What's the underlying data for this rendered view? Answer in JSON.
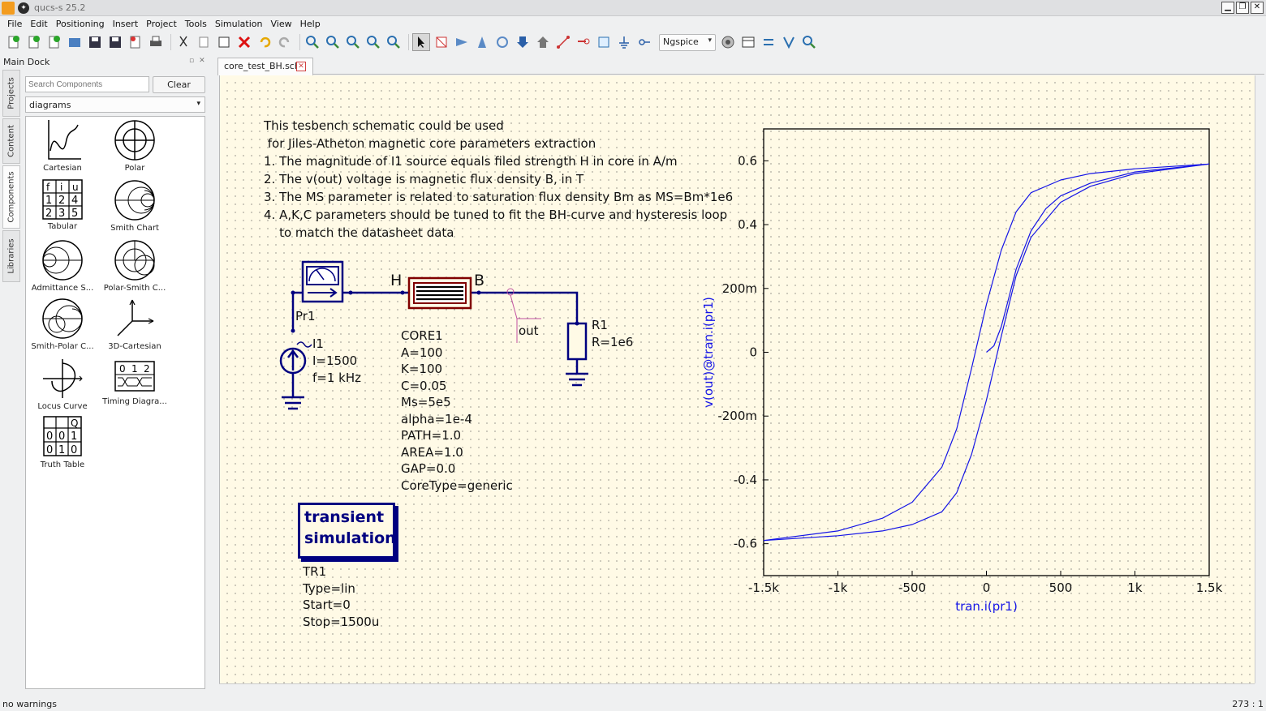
{
  "window": {
    "title": "qucs-s 25.2"
  },
  "menu": [
    "File",
    "Edit",
    "Positioning",
    "Insert",
    "Project",
    "Tools",
    "Simulation",
    "View",
    "Help"
  ],
  "toolbar": {
    "simulator": "Ngspice"
  },
  "dock": {
    "title": "Main Dock",
    "tabs": [
      "Projects",
      "Content",
      "Components",
      "Libraries"
    ],
    "search_placeholder": "Search Components",
    "clear_label": "Clear",
    "category": "diagrams",
    "components": [
      "Cartesian",
      "Polar",
      "Tabular",
      "Smith Chart",
      "Admittance S...",
      "Polar-Smith C...",
      "Smith-Polar C...",
      "3D-Cartesian",
      "Locus Curve",
      "Timing Diagra...",
      "Truth Table"
    ]
  },
  "document": {
    "tab_label": "core_test_BH.sch"
  },
  "schematic": {
    "notes": [
      "This tesbench schematic could be used",
      " for Jiles-Atheton magnetic core parameters extraction",
      "1. The magnitude of I1 source equals filed strength H in core in A/m",
      "2. The v(out) voltage is magnetic flux density B, in T",
      "3. The MS parameter is related to saturation flux density Bm as MS=Bm*1e6",
      "4. A,K,C parameters should be tuned to fit the BH-curve and hysteresis loop",
      "    to match the datasheet data"
    ],
    "probe": {
      "name": "Pr1"
    },
    "source": {
      "name": "I1",
      "props": [
        "I=1500",
        "f=1 kHz"
      ]
    },
    "core": {
      "pin_h": "H",
      "pin_b": "B",
      "name": "CORE1",
      "props": [
        "A=100",
        "K=100",
        "C=0.05",
        "Ms=5e5",
        "alpha=1e-4",
        "PATH=1.0",
        "AREA=1.0",
        "GAP=0.0",
        "CoreType=generic"
      ]
    },
    "label": "out",
    "resistor": {
      "name": "R1",
      "props": [
        "R=1e6"
      ]
    },
    "simulation": {
      "title": "transient\nsimulation",
      "name": "TR1",
      "props": [
        "Type=lin",
        "Start=0",
        "Stop=1500u"
      ]
    }
  },
  "chart_data": {
    "type": "line",
    "xlabel": "tran.i(pr1)",
    "ylabel": "v(out)@tran.i(pr1)",
    "xlim": [
      -1500,
      1500
    ],
    "ylim": [
      -0.7,
      0.7
    ],
    "x_ticks": [
      "-1.5k",
      "-1k",
      "-500",
      "0",
      "500",
      "1k",
      "1.5k"
    ],
    "y_ticks": [
      "0.6",
      "0.4",
      "200m",
      "0",
      "-200m",
      "-0.4",
      "-0.6"
    ],
    "grid": true,
    "line_color": "#1414e6",
    "series": [
      {
        "x": [
          0,
          50,
          100,
          150,
          200,
          300,
          400,
          500,
          700,
          1000,
          1500
        ],
        "y": [
          0,
          0.02,
          0.08,
          0.17,
          0.26,
          0.38,
          0.45,
          0.49,
          0.53,
          0.565,
          0.59
        ]
      },
      {
        "x": [
          1500,
          1000,
          700,
          500,
          300,
          200,
          100,
          0,
          -100,
          -200,
          -300,
          -500,
          -700,
          -1000,
          -1500
        ],
        "y": [
          0.59,
          0.575,
          0.56,
          0.54,
          0.5,
          0.44,
          0.32,
          0.15,
          -0.05,
          -0.24,
          -0.36,
          -0.47,
          -0.52,
          -0.56,
          -0.59
        ]
      },
      {
        "x": [
          -1500,
          -1000,
          -700,
          -500,
          -300,
          -200,
          -100,
          0,
          100,
          200,
          300,
          500,
          700,
          1000,
          1500
        ],
        "y": [
          -0.59,
          -0.575,
          -0.56,
          -0.54,
          -0.5,
          -0.44,
          -0.32,
          -0.15,
          0.05,
          0.24,
          0.36,
          0.47,
          0.52,
          0.56,
          0.59
        ]
      }
    ]
  },
  "status": {
    "left": "no warnings",
    "right": "273 : 1"
  }
}
